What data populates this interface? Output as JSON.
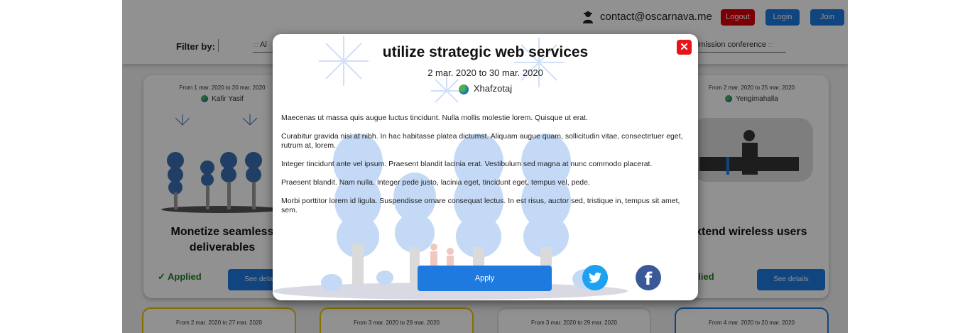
{
  "header": {
    "email": "contact@oscarnava.me",
    "logout_label": "Logout",
    "login_label": "Login",
    "join_label": "Join"
  },
  "filter": {
    "label": "Filter by:",
    "select_left_value": "Al",
    "select_right_value": "admission conference"
  },
  "cards": [
    {
      "date": "From 1 mar. 2020 to 20 mar. 2020",
      "place": "Kafir Yasif",
      "title": "Monetize seamless deliverables",
      "status": "✓ Applied",
      "button": "See details"
    },
    {
      "date": "From 2 mar. 2020 to 25 mar. 2020",
      "place": "Yengimahalla",
      "title": "Extend wireless users",
      "status": "Applied",
      "button": "See details"
    }
  ],
  "bottom_cards": [
    {
      "date": "From 2 mar. 2020 to 27 mar. 2020"
    },
    {
      "date": "From 3 mar. 2020 to 29 mar. 2020"
    },
    {
      "date": "From 3 mar. 2020 to 29 mar. 2020"
    },
    {
      "date": "From 4 mar. 2020 to 20 mar. 2020"
    }
  ],
  "modal": {
    "close_label": "✕",
    "title": "utilize strategic web services",
    "dates": "2 mar. 2020 to 30 mar. 2020",
    "place": "Xhafzotaj",
    "paragraphs": [
      "Maecenas ut massa quis augue luctus tincidunt. Nulla mollis molestie lorem. Quisque ut erat.",
      "Curabitur gravida nisi at nibh. In hac habitasse platea dictumst. Aliquam augue quam, sollicitudin vitae, consectetuer eget, rutrum at, lorem.",
      "Integer tincidunt ante vel ipsum. Praesent blandit lacinia erat. Vestibulum sed magna at nunc commodo placerat.",
      "Praesent blandit. Nam nulla. Integer pede justo, lacinia eget, tincidunt eget, tempus vel, pede.",
      "Morbi porttitor lorem id ligula. Suspendisse ornare consequat lectus. In est risus, auctor sed, tristique in, tempus sit amet, sem."
    ],
    "apply_label": "Apply",
    "twitter_icon": "twitter-icon",
    "facebook_label": "f"
  },
  "colors": {
    "primary": "#1f7ae0",
    "danger": "#d8000c",
    "applied": "#1e7d1e"
  }
}
